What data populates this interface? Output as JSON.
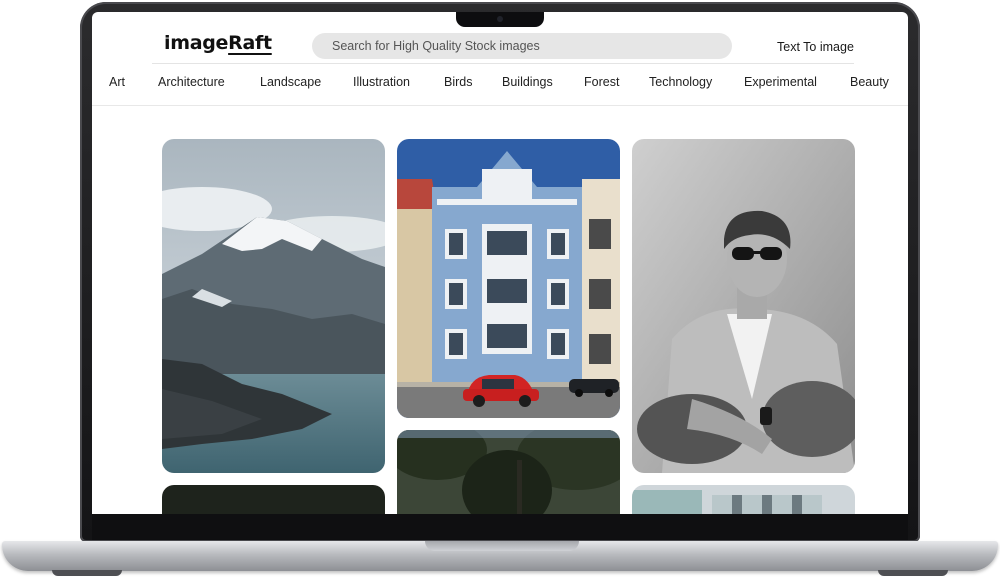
{
  "app": {
    "logo_prefix": "image",
    "logo_suffix": "Raft"
  },
  "search": {
    "placeholder": "Search for High Quality Stock images"
  },
  "header": {
    "text_to_image_label": "Text To image"
  },
  "categories": [
    "Art",
    "Architecture",
    "Landscape",
    "Illustration",
    "Birds",
    "Buildings",
    "Forest",
    "Technology",
    "Experimental",
    "Beauty"
  ],
  "gallery": [
    {
      "subject": "snowy mountain above a lake"
    },
    {
      "subject": "blue apartment building with red car"
    },
    {
      "subject": "black and white portrait of man in sunglasses"
    },
    {
      "subject": "tree canopy"
    },
    {
      "subject": "dark green image"
    },
    {
      "subject": "glass building facade"
    }
  ]
}
